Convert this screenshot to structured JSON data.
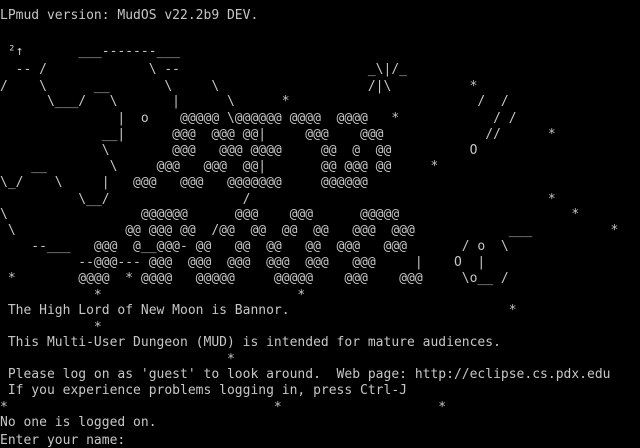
{
  "terminal": {
    "foreground": "#c6c6c6",
    "background": "#000000",
    "lines": [
      "LPmud version: MudOS v22.2b9 DEV.",
      "",
      " ²↑       ___-------___",
      "  -- /             \\ --                        _\\|/_",
      "/    \\      __       \\     \\                   /|\\          *",
      "      \\___/   \\       |      \\      *                        /  /",
      "               |  o    @@@@@ \\@@@@@@ @@@@  @@@@   *            / /",
      "             __|      @@@  @@@ @@|     @@@    @@@             //      *",
      "             \\        @@@   @@@ @@@@     @@  @  @@          O",
      "    __        \\     @@@   @@@  @@|       @@ @@@ @@     *",
      "\\_/    \\     |   @@@   @@@   @@@@@@@     @@@@@@",
      "          \\__/                 /                                      *",
      "\\                 @@@@@@      @@@    @@@      @@@@@                      *",
      " \\              @@ @@@ @@  /@@  @@  @@  @@   @@@  @@@            ___          *",
      "    --___   @@@  @__@@@- @@   @@  @@   @@  @@@   @@@       / o  \\",
      "          --@@@--- @@@  @@@  @@@  @@@  @@@   @@@     |    O  |",
      " *        @@@@  * @@@@   @@@@@     @@@@@    @@@    @@@     \\o__ /",
      "            *                         *",
      " The High Lord of New Moon is Bannor.                            *",
      "            *",
      " This Multi-User Dungeon (MUD) is intended for mature audiences.",
      "                             *",
      " Please log on as 'guest' to look around.  Web page: http://eclipse.cs.pdx.edu",
      " If you experience problems logging in, press Ctrl-J",
      "*                                  *                    *",
      "No one is logged on.",
      "Enter your name: "
    ]
  }
}
